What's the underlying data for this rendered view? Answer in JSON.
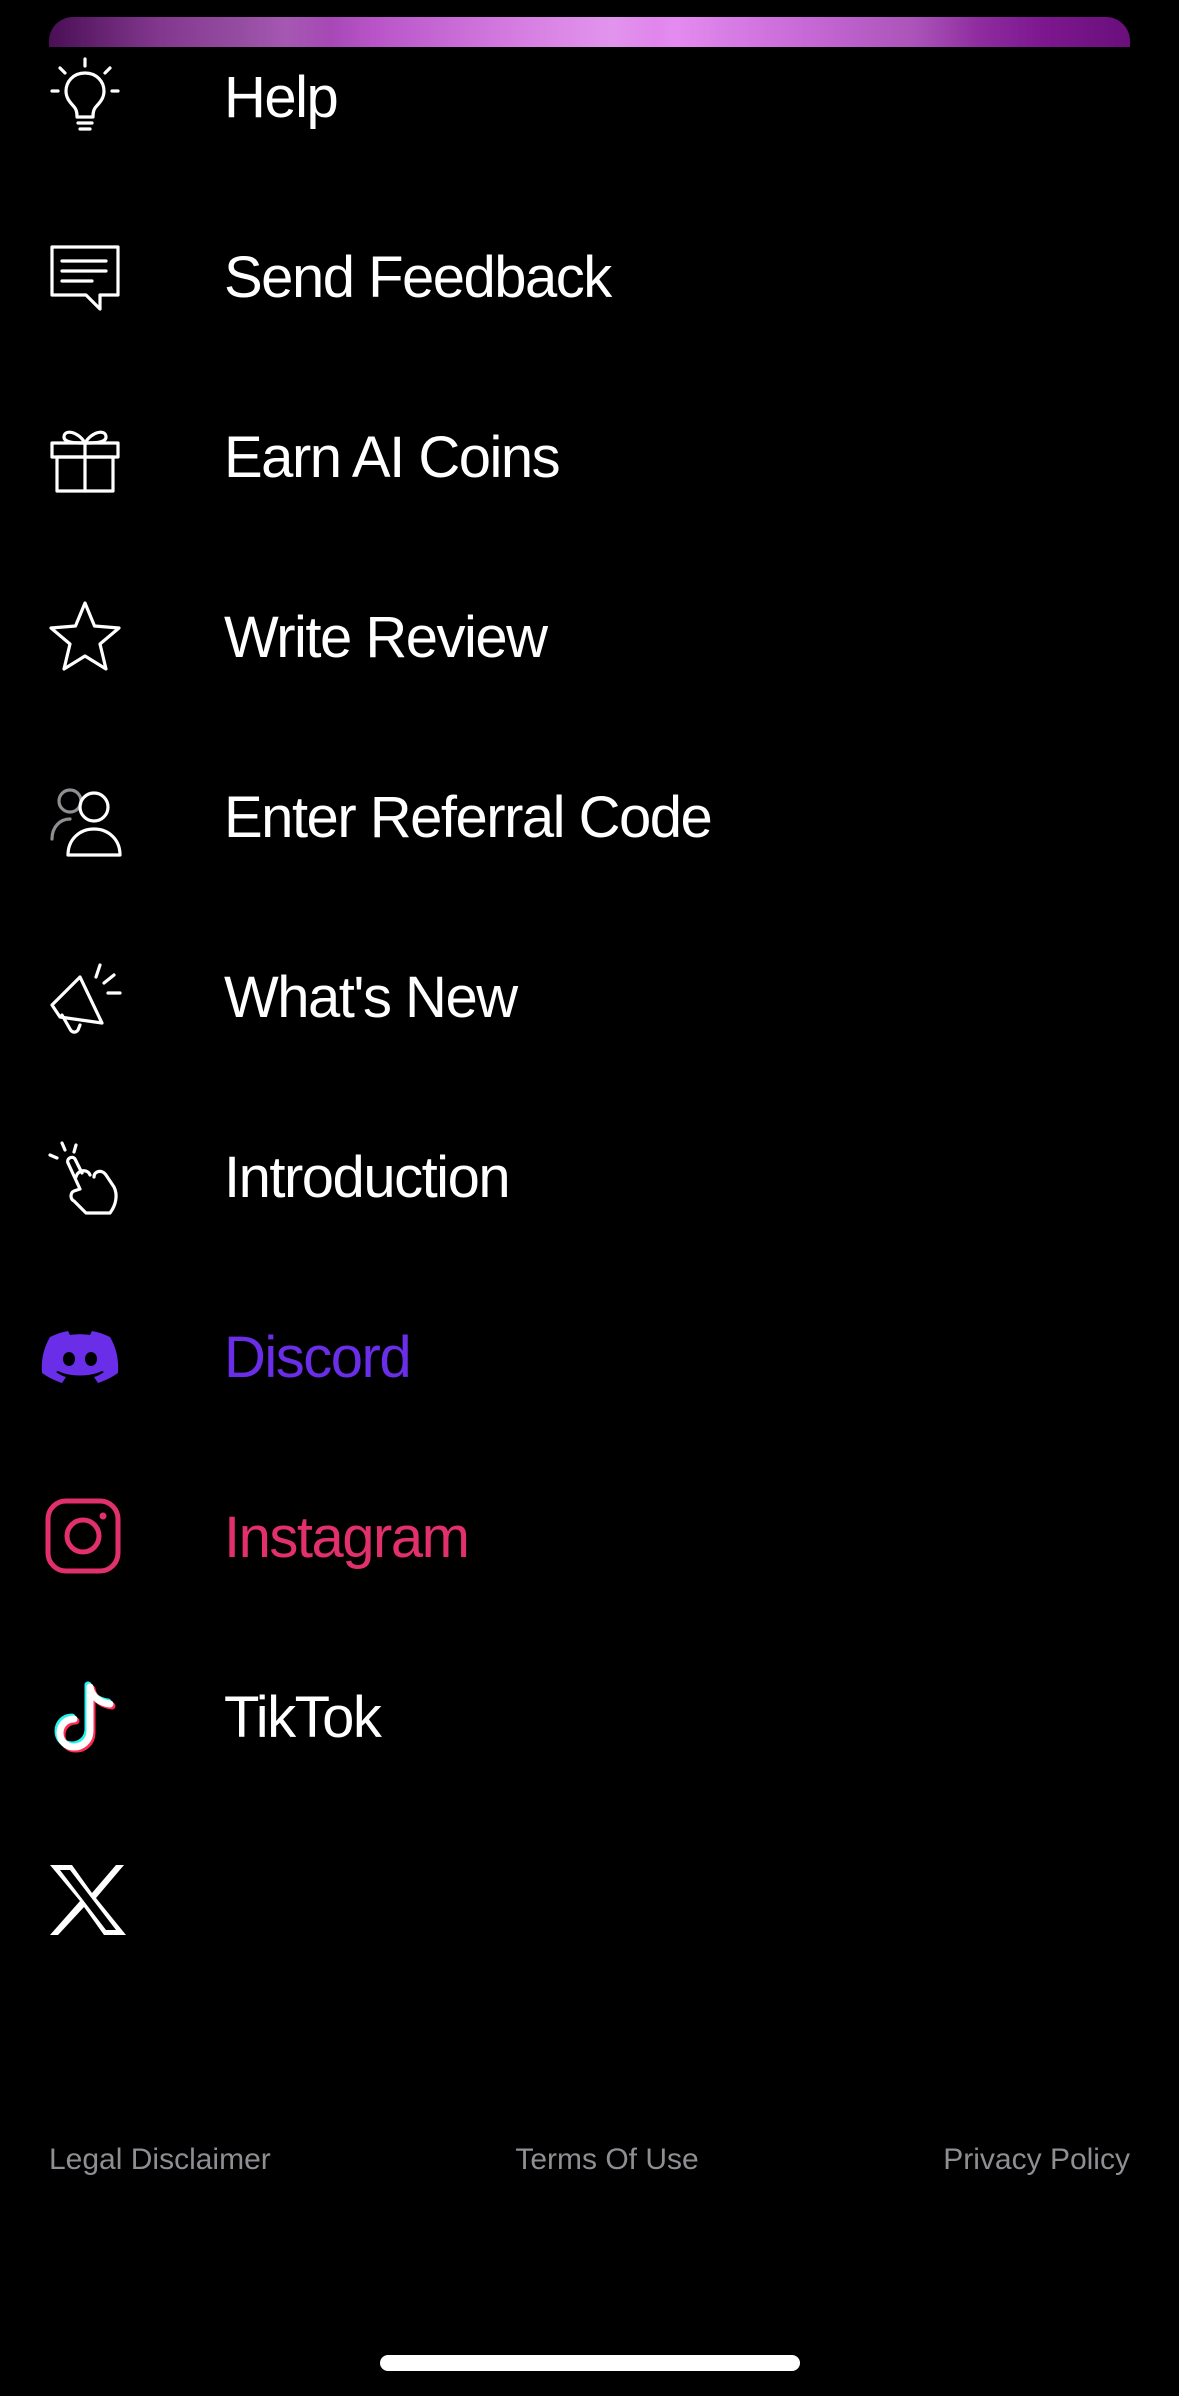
{
  "menu": {
    "items": [
      {
        "label": "Help",
        "icon": "lightbulb-icon"
      },
      {
        "label": "Send Feedback",
        "icon": "feedback-icon"
      },
      {
        "label": "Earn AI Coins",
        "icon": "gift-icon"
      },
      {
        "label": "Write Review",
        "icon": "star-icon"
      },
      {
        "label": "Enter Referral Code",
        "icon": "referral-users-icon"
      },
      {
        "label": "What's New",
        "icon": "megaphone-icon"
      },
      {
        "label": "Introduction",
        "icon": "tap-hand-icon"
      },
      {
        "label": "Discord",
        "icon": "discord-icon"
      },
      {
        "label": "Instagram",
        "icon": "instagram-icon"
      },
      {
        "label": "TikTok",
        "icon": "tiktok-icon"
      },
      {
        "label": "",
        "icon": "x-logo-icon"
      }
    ]
  },
  "footer": {
    "legal": "Legal Disclaimer",
    "terms": "Terms Of Use",
    "privacy": "Privacy Policy"
  },
  "colors": {
    "background": "#000000",
    "text": "#ffffff",
    "discord": "#6a2ee8",
    "instagram": "#e1306c",
    "footer_text": "#8e8e93",
    "tiktok_cyan": "#25f4ee",
    "tiktok_red": "#fe2c55"
  }
}
